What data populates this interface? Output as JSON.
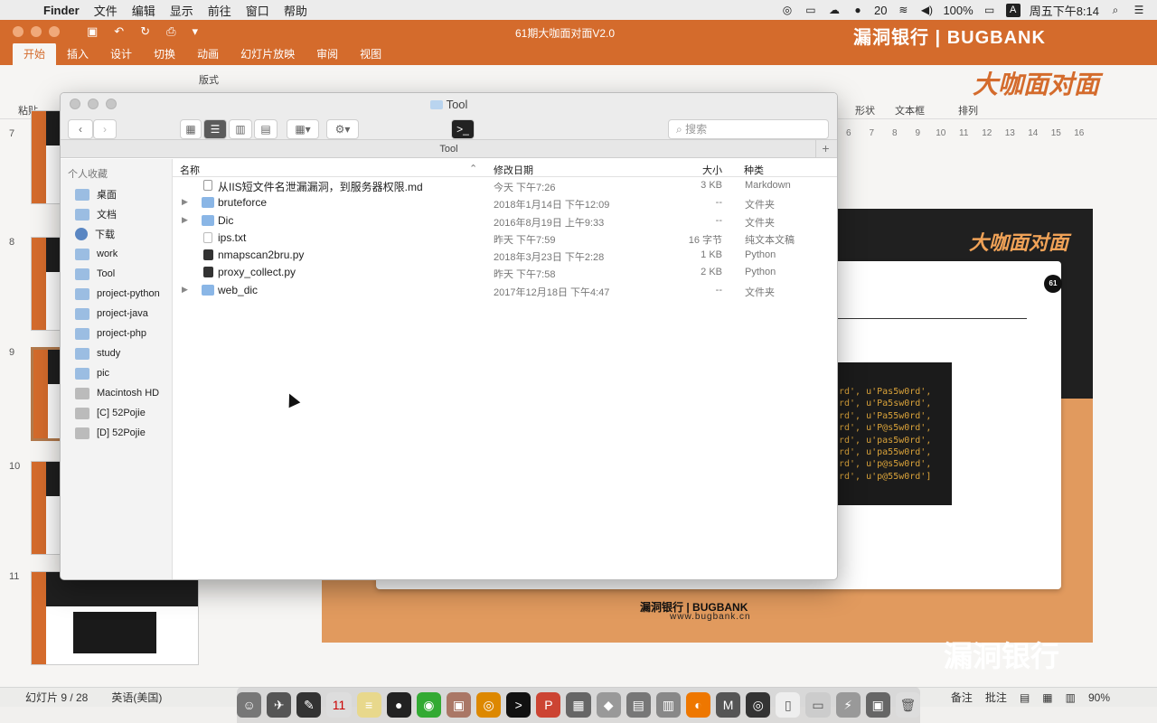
{
  "menubar": {
    "app": "Finder",
    "items": [
      "文件",
      "编辑",
      "显示",
      "前往",
      "窗口",
      "帮助"
    ],
    "notify_count": "20",
    "battery": "100%",
    "input_lang": "A",
    "clock": "周五下午8:14"
  },
  "ppt": {
    "doc_title": "61期大咖面对面V2.0",
    "brand": "漏洞银行 | BUGBANK",
    "tabs": [
      "开始",
      "插入",
      "设计",
      "切换",
      "动画",
      "幻灯片放映",
      "审阅",
      "视图"
    ],
    "ribbon": {
      "paste": "粘贴",
      "layout": "版式",
      "shape": "形状",
      "textbox": "文本框",
      "arrange": "排列"
    },
    "logo_text": "大咖面对面",
    "ruler": [
      "6",
      "7",
      "8",
      "9",
      "10",
      "11",
      "12",
      "13",
      "14",
      "15",
      "16"
    ],
    "slide_numbers": [
      "7",
      "8",
      "9",
      "10",
      "11"
    ],
    "slide": {
      "title": "大咖面对面",
      "badge": "61",
      "code_lines": [
        "rd', u'Pas5w0rd',",
        "rd', u'Pa5sw0rd',",
        "rd', u'Pa55w0rd',",
        "rd', u'P@s5w0rd',",
        "rd', u'pas5w0rd',",
        "rd', u'pa55w0rd',",
        "rd', u'p@s5w0rd',",
        "rd', u'p@55w0rd']"
      ],
      "footer_logo": "漏洞银行 | BUGBANK",
      "footer_url": "www.bugbank.cn",
      "watermark": "漏洞银行"
    },
    "status": {
      "slide_pos": "幻灯片 9 / 28",
      "language": "英语(美国)",
      "notes": "备注",
      "comments": "批注",
      "zoom": "90%"
    }
  },
  "finder": {
    "title": "Tool",
    "path": "Tool",
    "search_placeholder": "搜索",
    "sidebar_header": "个人收藏",
    "sidebar": [
      "桌面",
      "文档",
      "下载",
      "work",
      "Tool",
      "project-python",
      "project-java",
      "project-php",
      "study",
      "pic",
      "Macintosh HD",
      "[C] 52Pojie",
      "[D] 52Pojie"
    ],
    "columns": {
      "name": "名称",
      "date": "修改日期",
      "size": "大小",
      "kind": "种类"
    },
    "files": [
      {
        "name": "从IIS短文件名泄漏漏洞，到服务器权限.md",
        "date": "今天 下午7:26",
        "size": "3 KB",
        "kind": "Markdown",
        "type": "doc",
        "folder": false
      },
      {
        "name": "bruteforce",
        "date": "2018年1月14日 下午12:09",
        "size": "--",
        "kind": "文件夹",
        "type": "folder",
        "folder": true
      },
      {
        "name": "Dic",
        "date": "2016年8月19日 上午9:33",
        "size": "--",
        "kind": "文件夹",
        "type": "folder",
        "folder": true
      },
      {
        "name": "ips.txt",
        "date": "昨天 下午7:59",
        "size": "16 字节",
        "kind": "纯文本文稿",
        "type": "txt",
        "folder": false
      },
      {
        "name": "nmapscan2bru.py",
        "date": "2018年3月23日 下午2:28",
        "size": "1 KB",
        "kind": "Python",
        "type": "py",
        "folder": false
      },
      {
        "name": "proxy_collect.py",
        "date": "昨天 下午7:58",
        "size": "2 KB",
        "kind": "Python",
        "type": "py",
        "folder": false
      },
      {
        "name": "web_dic",
        "date": "2017年12月18日 下午4:47",
        "size": "--",
        "kind": "文件夹",
        "type": "folder",
        "folder": true
      }
    ]
  }
}
